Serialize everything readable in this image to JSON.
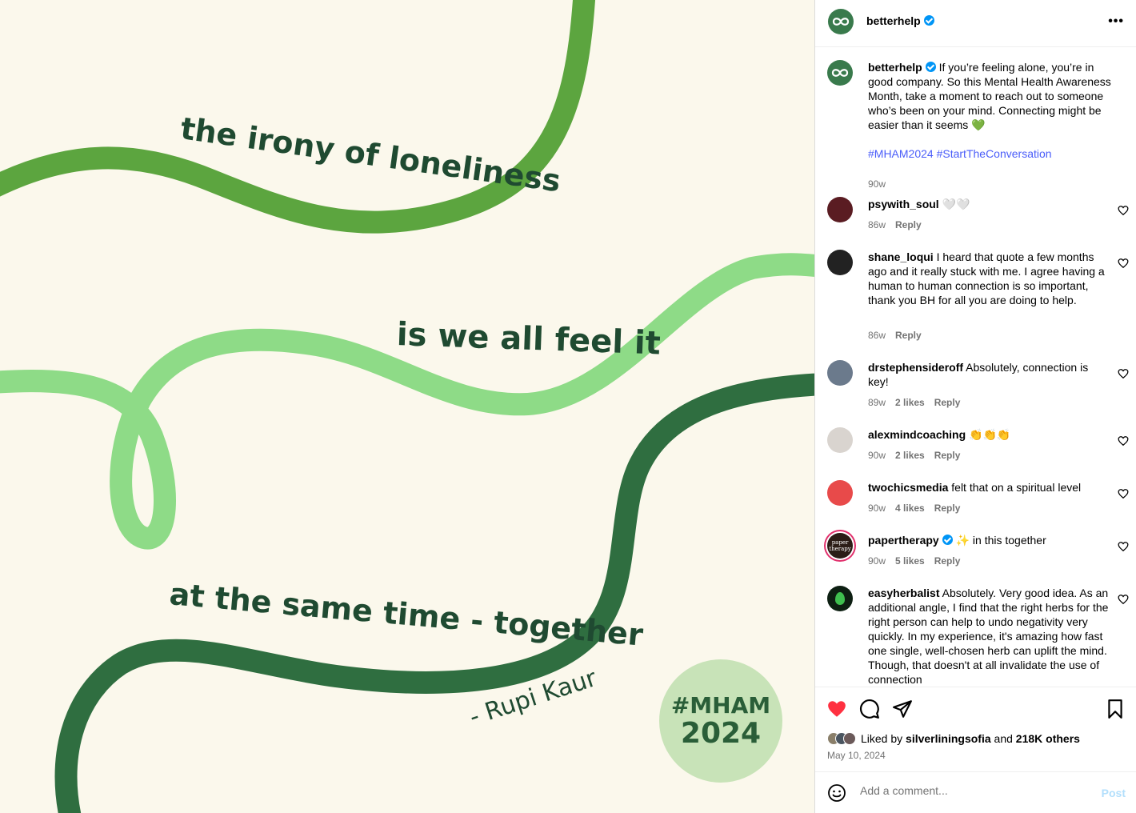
{
  "image": {
    "line1": "the irony of loneliness",
    "line2": "is we all feel it",
    "line3": "at the same time - together",
    "author": "-  Rupi Kaur",
    "badge_line1": "#MHAM",
    "badge_line2": "2024",
    "colors": {
      "bg": "#fbf8ec",
      "dark": "#2f6e40",
      "mid": "#5ca53f",
      "light": "#8edb87",
      "text": "#1f4a31",
      "badge": "#c8e3b8"
    }
  },
  "header": {
    "username": "betterhelp",
    "more_icon": "more-horizontal-icon"
  },
  "caption": {
    "username": "betterhelp",
    "text": "If you’re feeling alone, you’re in good company. So this Mental Health Awareness Month, take a moment to reach out to someone who’s been on your mind. Connecting might be easier than it seems 💚",
    "hashtags": "#MHAM2024 #StartTheConversation",
    "time": "90w"
  },
  "comments": [
    {
      "username": "psywith_soul",
      "text": "🤍🤍",
      "time": "86w",
      "likes": "",
      "reply": "Reply"
    },
    {
      "username": "shane_loqui",
      "text": "I heard that quote a few months ago and it really stuck with me. I agree having a human to human connection is so important, thank you BH for all you are doing to help.",
      "time": "86w",
      "likes": "",
      "reply": "Reply"
    },
    {
      "username": "drstephensideroff",
      "text": "Absolutely, connection is key!",
      "time": "89w",
      "likes": "2 likes",
      "reply": "Reply"
    },
    {
      "username": "alexmindcoaching",
      "text": "👏👏👏",
      "time": "90w",
      "likes": "2 likes",
      "reply": "Reply"
    },
    {
      "username": "twochicsmedia",
      "text": "felt that on a spiritual level",
      "time": "90w",
      "likes": "4 likes",
      "reply": "Reply"
    },
    {
      "username": "papertherapy",
      "text": "✨ in this together",
      "time": "90w",
      "likes": "5 likes",
      "reply": "Reply"
    },
    {
      "username": "easyherbalist",
      "text": "Absolutely. Very good idea. As an additional angle, I find that the right herbs for the right person can help to undo negativity very quickly. In my experience, it's amazing how fast one single, well-chosen herb can uplift the mind. Though, that doesn't at all invalidate the use of connection",
      "time": "",
      "likes": "",
      "reply": ""
    }
  ],
  "papertherapy_avatar": "paper therapy",
  "likes": {
    "prefix": "Liked by ",
    "user": "silverliningsofia",
    "mid": " and ",
    "count": "218K others"
  },
  "date": "May 10, 2024",
  "add_comment": {
    "placeholder": "Add a comment...",
    "post_label": "Post"
  }
}
